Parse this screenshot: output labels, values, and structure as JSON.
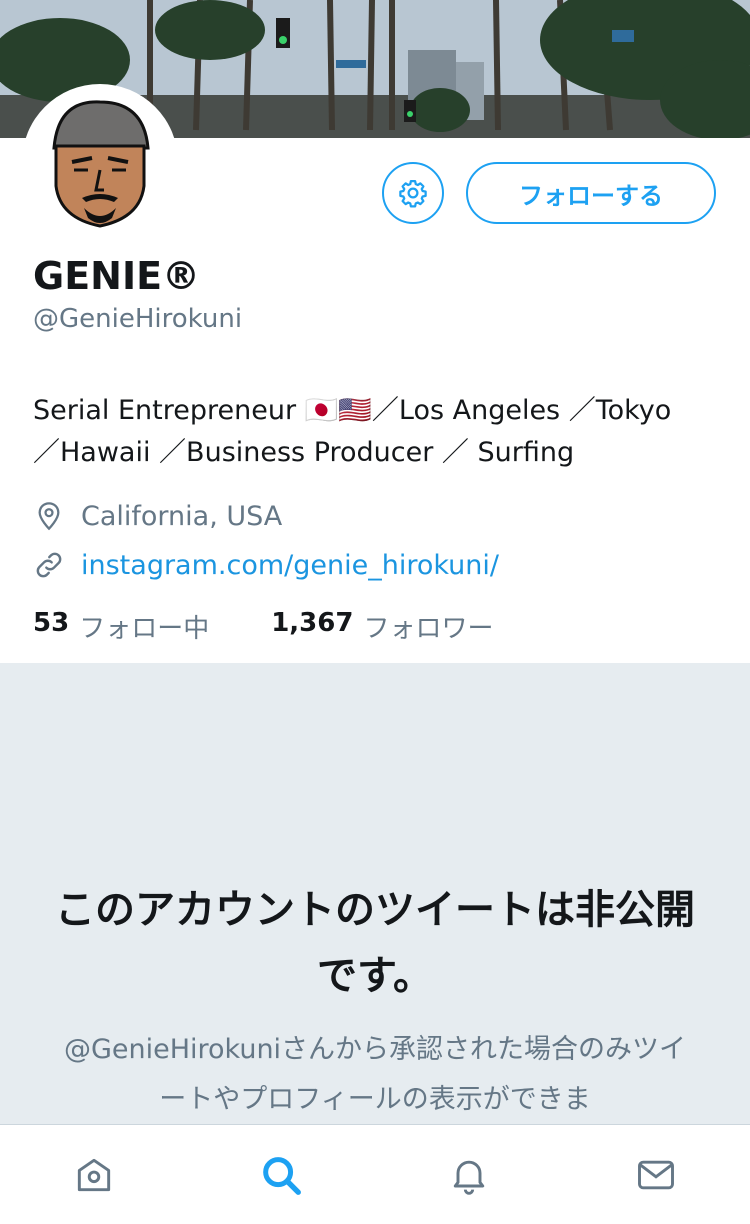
{
  "profile": {
    "display_name": "GENIE®",
    "handle": "@GenieHirokuni",
    "bio_line1": "Serial Entrepreneur 🇯🇵🇺🇸／Los Angeles ／Tokyo",
    "bio_line2": "／Hawaii ／Business Producer ／ Surfing",
    "location": "California, USA",
    "website": "instagram.com/genie_hirokuni/",
    "following_count": "53",
    "following_label": "フォロー中",
    "followers_count": "1,367",
    "followers_label": "フォロワー"
  },
  "actions": {
    "follow_label": "フォローする"
  },
  "private_notice": {
    "title": "このアカウントのツイートは非公開です。",
    "description": "@GenieHirokuniさんから承認された場合のみツイートやプロフィールの表示ができま"
  },
  "tabbar": {
    "items": [
      {
        "icon": "home-icon"
      },
      {
        "icon": "search-icon",
        "active": true
      },
      {
        "icon": "notifications-icon"
      },
      {
        "icon": "messages-icon"
      }
    ]
  },
  "colors": {
    "accent": "#1da1f2",
    "link": "#1b95e0",
    "secondary_text": "#657786",
    "private_bg": "#e6ecf0"
  }
}
